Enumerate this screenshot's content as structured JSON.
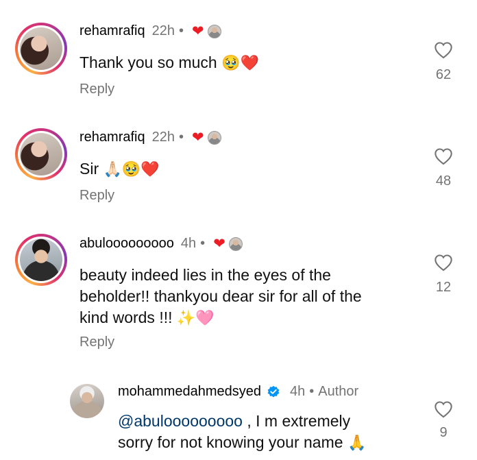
{
  "comments": [
    {
      "username": "rehamrafiq",
      "time": "22h",
      "sep": "•",
      "text": "Thank you so much",
      "emoji": "🥹❤️",
      "reply_label": "Reply",
      "likes": "62"
    },
    {
      "username": "rehamrafiq",
      "time": "22h",
      "sep": "•",
      "text": "Sir",
      "emoji": "🙏🏻🥹❤️",
      "reply_label": "Reply",
      "likes": "48"
    },
    {
      "username": "abulooooooooo",
      "time": "4h",
      "sep": "•",
      "text_lines": [
        "beauty indeed lies in the eyes of the",
        "beholder!! thankyou dear sir for all of the",
        "kind words !!!"
      ],
      "emoji": "✨🩷",
      "reply_label": "Reply",
      "likes": "12"
    },
    {
      "username": "mohammedahmedsyed",
      "time": "4h",
      "sep": "•",
      "author_label": "Author",
      "mention": "@abulooooooooo",
      "text_line1_rest": " , I m extremely",
      "text_line2": "sorry for not knowing your name",
      "emoji": "🙏",
      "likes": "9"
    }
  ],
  "colors": {
    "heart": "#ed1c24",
    "secondary_text": "#737373",
    "mention": "#00376b",
    "verified": "#0095f6"
  },
  "icons": {
    "like": "heart-outline-icon",
    "liked_by_author": "heart-red-icon",
    "verified": "verified-badge-icon"
  }
}
